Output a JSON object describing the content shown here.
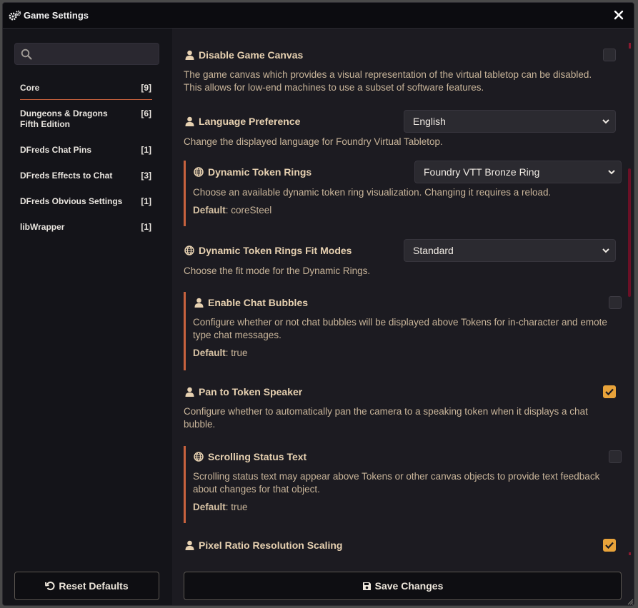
{
  "window": {
    "title": "Game Settings"
  },
  "search": {
    "placeholder": "",
    "value": ""
  },
  "categories": [
    {
      "label": "Core",
      "count": "[9]",
      "active": true
    },
    {
      "label": "Dungeons & Dragons Fifth Edition",
      "count": "[6]"
    },
    {
      "label": "DFreds Chat Pins",
      "count": "[1]"
    },
    {
      "label": "DFreds Effects to Chat",
      "count": "[3]"
    },
    {
      "label": "DFreds Obvious Settings",
      "count": "[1]"
    },
    {
      "label": "libWrapper",
      "count": "[1]"
    }
  ],
  "settings": [
    {
      "name": "Disable Game Canvas",
      "scope_icon": "user-icon",
      "type": "checkbox",
      "checked": false,
      "hint": "The game canvas which provides a visual representation of the virtual tabletop can be disabled. This allows for low-end machines to use a subset of software features."
    },
    {
      "name": "Language Preference",
      "scope_icon": "user-icon",
      "type": "select",
      "value": "English",
      "hint": "Change the displayed language for Foundry Virtual Tabletop."
    },
    {
      "name": "Dynamic Token Rings",
      "scope_icon": "globe-icon",
      "type": "select",
      "value": "Foundry VTT Bronze Ring",
      "hint": "Choose an available dynamic token ring visualization. Changing it requires a reload.",
      "default_label": "Default",
      "default_value": ": coreSteel"
    },
    {
      "name": "Dynamic Token Rings Fit Modes",
      "scope_icon": "globe-icon",
      "type": "select",
      "value": "Standard",
      "hint": "Choose the fit mode for the Dynamic Rings."
    },
    {
      "name": "Enable Chat Bubbles",
      "scope_icon": "user-icon",
      "type": "checkbox",
      "checked": false,
      "hint": "Configure whether or not chat bubbles will be displayed above Tokens for in-character and emote type chat messages.",
      "default_label": "Default",
      "default_value": ": true"
    },
    {
      "name": "Pan to Token Speaker",
      "scope_icon": "user-icon",
      "type": "checkbox",
      "checked": true,
      "hint": "Configure whether to automatically pan the camera to a speaking token when it displays a chat bubble."
    },
    {
      "name": "Scrolling Status Text",
      "scope_icon": "globe-icon",
      "type": "checkbox",
      "checked": false,
      "hint": "Scrolling status text may appear above Tokens or other canvas objects to provide text feedback about changes for that object.",
      "default_label": "Default",
      "default_value": ": true"
    },
    {
      "name": "Pixel Ratio Resolution Scaling",
      "scope_icon": "user-icon",
      "type": "checkbox",
      "checked": true
    }
  ],
  "buttons": {
    "reset": "Reset Defaults",
    "save": "Save Changes"
  },
  "colors": {
    "accent": "#c8623e",
    "checkbox_on": "#e8a33a",
    "scrollbar": "#6b1026"
  }
}
